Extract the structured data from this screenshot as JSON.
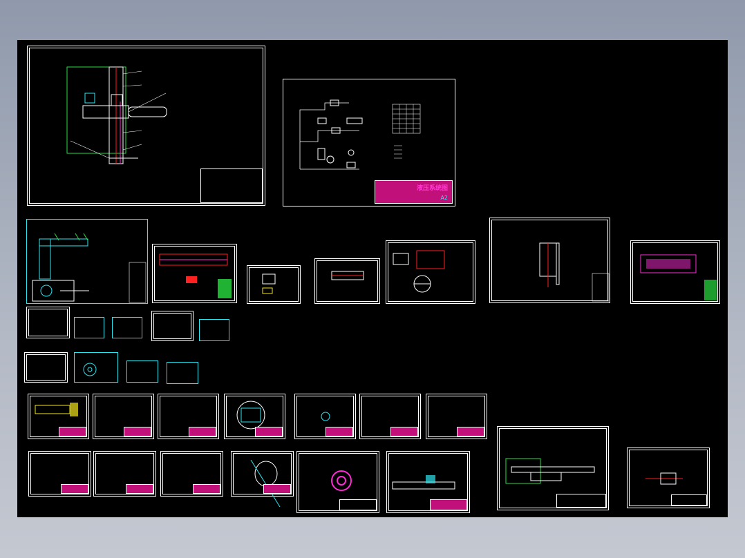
{
  "drawing": {
    "hydraulic_sheet_title": "液压系统图",
    "hydraulic_sheet_mark": "A2"
  },
  "colors": {
    "background": "#000000",
    "line": "#ffffff",
    "cyan": "#2ee6f0",
    "magenta": "#ff2bd6",
    "red": "#ff2020",
    "green": "#28e040",
    "yellow": "#f2e51c"
  }
}
